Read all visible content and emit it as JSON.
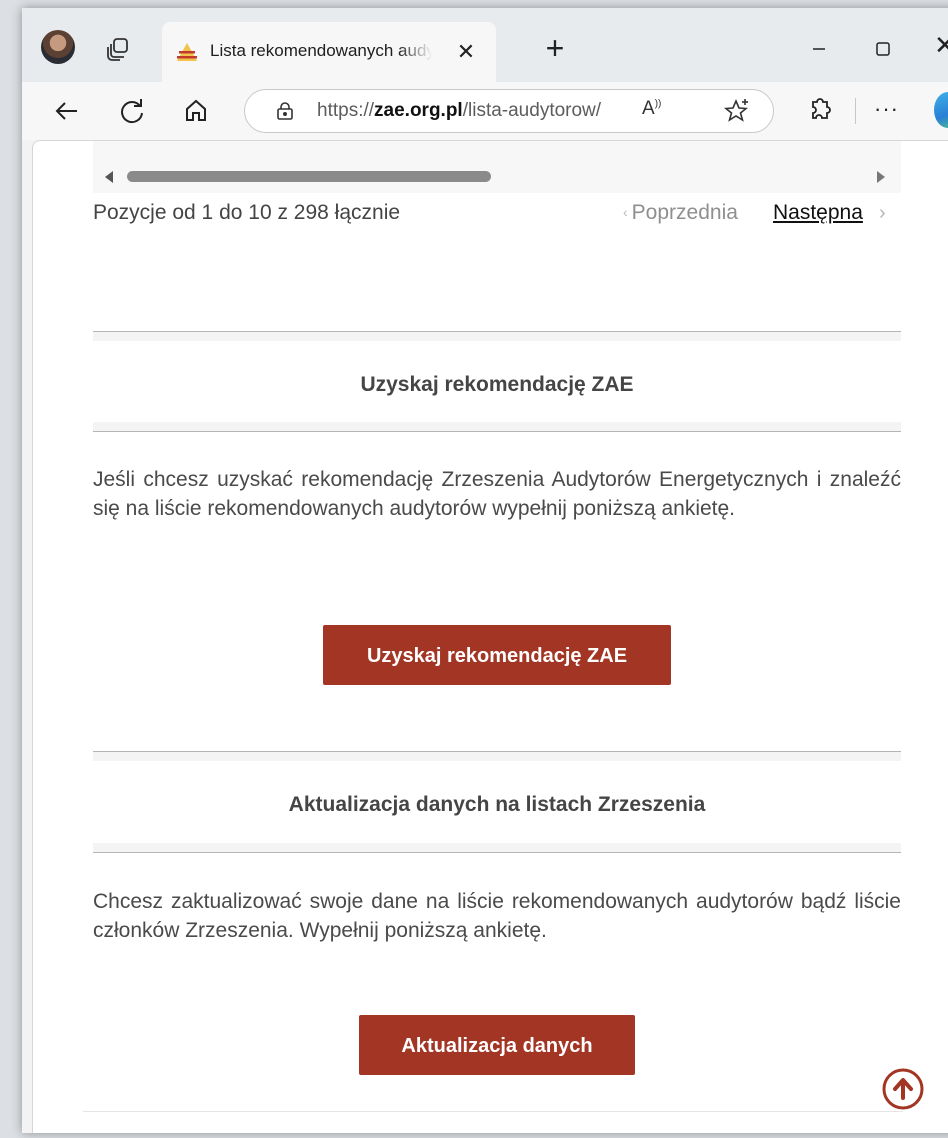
{
  "browser": {
    "tab_title": "Lista rekomendowanych audytorów",
    "tab_close": "✕",
    "new_tab": "+",
    "window_close": "✕",
    "url_prefix": "https://",
    "url_domain": "zae.org.pl",
    "url_path": "/lista-audytorow/",
    "read_aloud": "A",
    "more": "···"
  },
  "table_nav": {
    "info": "Pozycje od 1 do 10 z 298 łącznie",
    "prev_label": "Poprzednia",
    "next_label": "Następna"
  },
  "sections": [
    {
      "title": "Uzyskaj rekomendację ZAE",
      "text": "Jeśli chcesz uzyskać rekomendację Zrzeszenia Audytorów Energetycznych i znaleźć się na liście rekomendowanych audytorów wypełnij poniższą ankietę.",
      "button": "Uzyskaj rekomendację ZAE"
    },
    {
      "title": "Aktualizacja danych na listach Zrzeszenia",
      "text": "Chcesz zaktualizować swoje dane na liście rekomendowanych audytorów bądź liście członków Zrzeszenia. Wypełnij poniższą ankietę.",
      "button": "Aktualizacja danych"
    }
  ],
  "colors": {
    "button_bg": "#a33524",
    "text": "#4a4a4a",
    "link": "#111111"
  }
}
